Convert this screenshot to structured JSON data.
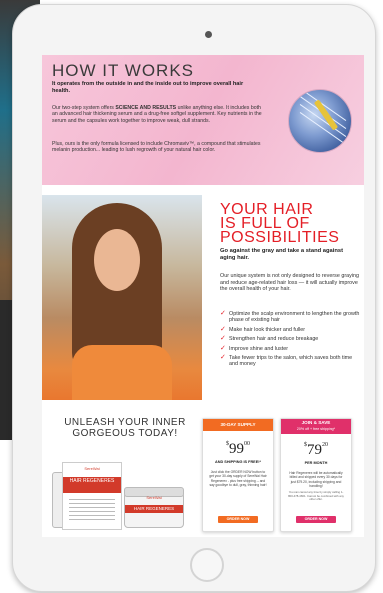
{
  "how_it_works": {
    "title": "HOW IT WORKS",
    "subtitle": "It operates from the outside in and the inside out to improve overall hair health.",
    "paragraph1_pre": "Our two-step system offers ",
    "paragraph1_bold": "SCIENCE AND RESULTS",
    "paragraph1_post": " unlike anything else. It includes both an advanced hair thickening serum and a drug-free softgel supplement. Key nutrients in the serum and the capsules work together to improve weak, dull strands.",
    "paragraph2": "Plus, ours is the only formula licensed to include Chromaviv™, a compound that stimulates melanin production... leading to lush regrowth of your natural hair color."
  },
  "your_hair": {
    "title_line1": "YOUR HAIR",
    "title_line2": "IS FULL OF",
    "title_line3": "POSSIBILITIES",
    "subtitle": "Go against the gray and take a stand against aging hair.",
    "paragraph": "Our unique system is not only designed to reverse graying and reduce age-related hair loss — it will actually improve the overall health of your hair.",
    "bullets": [
      "Optimize the scalp environment to lengthen the growth phase of existing hair",
      "Make hair look thicker and fuller",
      "Strengthen hair and reduce breakage",
      "Improve shine and luster",
      "Take fewer trips to the salon, which saves both time and money"
    ]
  },
  "bottom": {
    "headline": "UNLEASH YOUR INNER GORGEOUS TODAY!",
    "product": {
      "brand": "SereWai",
      "name": "HAIR REGENERES"
    },
    "offer1": {
      "header": "30-DAY SUPPLY",
      "currency": "$",
      "price": "99",
      "cents": "00",
      "note": "AND SHIPPING IS FREE!*",
      "desc": "Just click the ORDER NOW button to get your 30-day supply of SereWai Hair Regenerex - plus free shipping -- and say goodbye to dull, gray, thinning hair!",
      "button": "ORDER NOW"
    },
    "offer2": {
      "header_line1": "JOIN & SAVE",
      "header_line2": "20% off + free shipping*",
      "currency": "$",
      "price": "79",
      "cents": "20",
      "note": "PER MONTH",
      "desc": "Hair Regenerex will be automatically billed and shipped every 30 days for just $79.20, including shipping and handling!",
      "fine": "You can cancel any time by simply calling 1-800-478-4661. Cannot be combined with any other offer.",
      "button": "ORDER NOW"
    }
  },
  "colors": {
    "accent_red": "#e41e26",
    "orange": "#f26b22",
    "pink": "#e0306a"
  }
}
